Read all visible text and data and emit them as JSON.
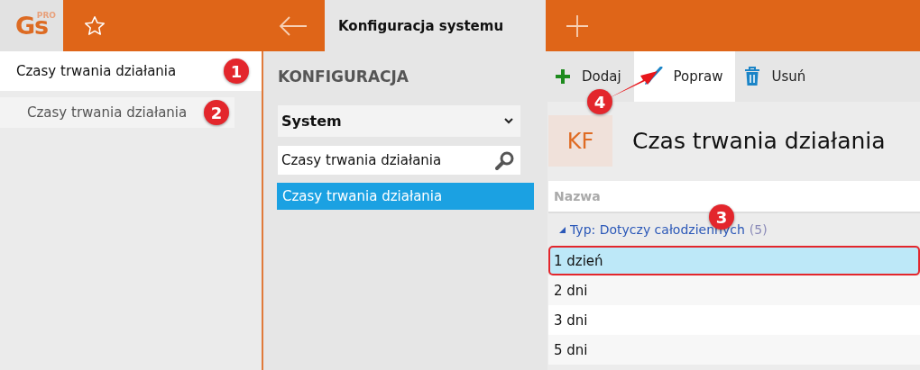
{
  "app": {
    "logo": "Gs",
    "logo_badge": "PRO"
  },
  "tabs": [
    {
      "label": "Konfiguracja systemu",
      "selected": true
    }
  ],
  "history": [
    {
      "label": "Czasy trwania działania",
      "selected": true,
      "marker": "1"
    },
    {
      "label": "Czasy trwania działania",
      "selected": false,
      "marker": "2"
    }
  ],
  "navigation": {
    "title": "KONFIGURACJA",
    "category": "System",
    "search": "Czasy trwania działania",
    "items": [
      {
        "label": "Czasy trwania działania",
        "selected": true
      }
    ]
  },
  "toolbar": [
    {
      "kind": "add",
      "label": "Dodaj",
      "selected": false
    },
    {
      "kind": "edit",
      "label": "Popraw",
      "selected": true,
      "marker": "4"
    },
    {
      "kind": "delete",
      "label": "Usuń",
      "selected": false
    }
  ],
  "header": {
    "initials": "KF",
    "title": "Czas trwania działania"
  },
  "table": {
    "columns": [
      "Nazwa"
    ],
    "group": {
      "label": "Typ: Dotyczy całodziennych",
      "count": "(5)",
      "expanded": true,
      "marker": "3"
    },
    "rows": [
      {
        "name": "1 dzień",
        "selected": true
      },
      {
        "name": "2 dni",
        "selected": false
      },
      {
        "name": "3 dni",
        "selected": false
      },
      {
        "name": "5 dni",
        "selected": false
      }
    ]
  }
}
